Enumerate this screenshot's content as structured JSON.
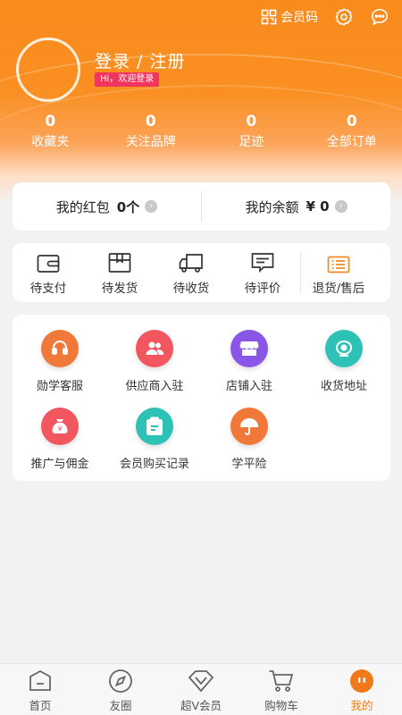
{
  "header": {
    "member_code_label": "会员码",
    "login_title": "登录 / 注册",
    "welcome": "Hi，欢迎登录"
  },
  "stats": [
    {
      "num": "0",
      "label": "收藏夹"
    },
    {
      "num": "0",
      "label": "关注品牌"
    },
    {
      "num": "0",
      "label": "足迹"
    },
    {
      "num": "0",
      "label": "全部订单"
    }
  ],
  "wallet": {
    "red_packet_label": "我的红包",
    "red_packet_value": "0个",
    "balance_label": "我的余额",
    "balance_value": "¥ 0"
  },
  "orders": [
    {
      "label": "待支付",
      "icon": "wallet-icon"
    },
    {
      "label": "待发货",
      "icon": "package-icon"
    },
    {
      "label": "待收货",
      "icon": "truck-icon"
    },
    {
      "label": "待评价",
      "icon": "comment-icon"
    },
    {
      "label": "退货/售后",
      "icon": "return-list-icon"
    }
  ],
  "services": [
    {
      "label": "勋学客服",
      "icon": "headset-icon",
      "color": "#f0793a"
    },
    {
      "label": "供应商入驻",
      "icon": "people-icon",
      "color": "#f2565f"
    },
    {
      "label": "店铺入驻",
      "icon": "store-icon",
      "color": "#8a56e8"
    },
    {
      "label": "收货地址",
      "icon": "location-icon",
      "color": "#2ec2b6"
    },
    {
      "label": "推广与佣金",
      "icon": "money-bag-icon",
      "color": "#f2565f"
    },
    {
      "label": "会员购买记录",
      "icon": "clipboard-icon",
      "color": "#2ec2b6"
    },
    {
      "label": "学平险",
      "icon": "umbrella-icon",
      "color": "#f0793a"
    }
  ],
  "tabs": [
    {
      "label": "首页",
      "icon": "home-icon"
    },
    {
      "label": "友圈",
      "icon": "compass-icon"
    },
    {
      "label": "超V会员",
      "icon": "diamond-icon"
    },
    {
      "label": "购物车",
      "icon": "cart-icon"
    },
    {
      "label": "我的",
      "icon": "profile-icon",
      "active": true
    }
  ],
  "colors": {
    "accent": "#f98b1c",
    "active_tab": "#f07a1a",
    "badge": "#f0355e"
  }
}
